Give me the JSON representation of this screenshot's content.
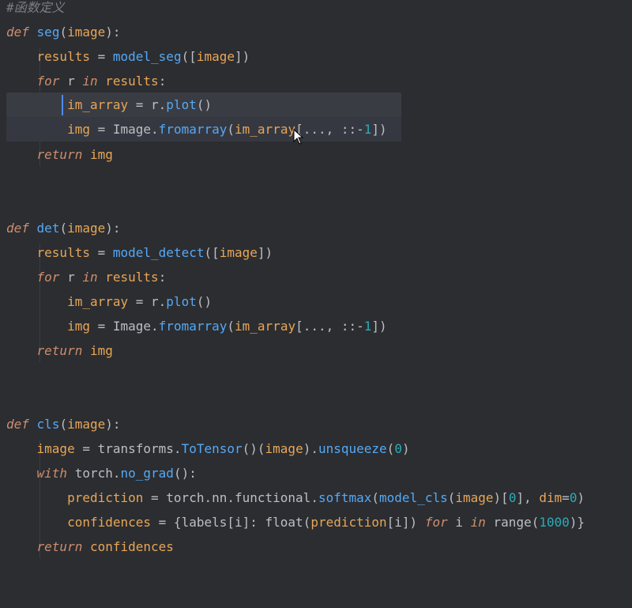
{
  "editor": {
    "comment": "#函数定义",
    "lines": [
      "def seg(image):",
      "    results = model_seg([image])",
      "    for r in results:",
      "        im_array = r.plot()",
      "        img = Image.fromarray(im_array[..., ::-1])",
      "    return img",
      "def det(image):",
      "    results = model_detect([image])",
      "    for r in results:",
      "        im_array = r.plot()",
      "        img = Image.fromarray(im_array[..., ::-1])",
      "    return img",
      "def cls(image):",
      "    image = transforms.ToTensor()(image).unsqueeze(0)",
      "    with torch.no_grad():",
      "        prediction = torch.nn.functional.softmax(model_cls(image)[0], dim=0)",
      "        confidences = {labels[i]: float(prediction[i]) for i in range(1000)}",
      "    return confidences"
    ]
  },
  "colors": {
    "background": "#2b2d31",
    "keyword": "#cf8e6d",
    "function": "#56a8f5",
    "number": "#2aacb8",
    "text": "#bcbec4",
    "comment": "#7a7e85"
  },
  "icons": {
    "cursor": "mouse-pointer-icon",
    "caret": "text-caret"
  }
}
